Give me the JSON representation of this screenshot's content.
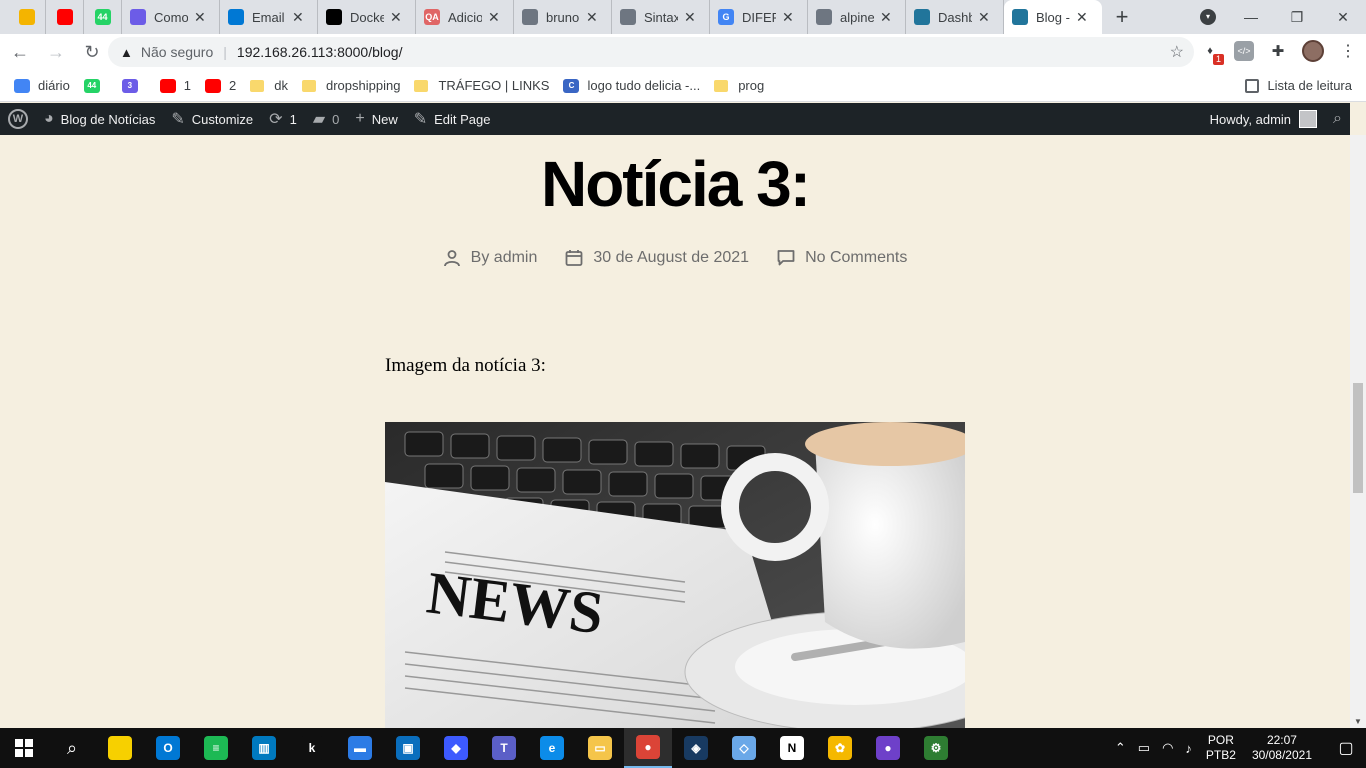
{
  "browser": {
    "tabs": [
      {
        "title": "",
        "favicon_color": "#f4b400",
        "small": true
      },
      {
        "title": "",
        "favicon_color": "#ff0000",
        "small": true
      },
      {
        "title": "",
        "favicon_color": "#25d366",
        "favicon_text": "44",
        "small": true
      },
      {
        "title": "Como",
        "favicon_color": "#6c5ce7"
      },
      {
        "title": "Email",
        "favicon_color": "#0078d4"
      },
      {
        "title": "Docke",
        "favicon_color": "#000000"
      },
      {
        "title": "Adicio",
        "favicon_color": "#e06666",
        "favicon_text": "QA"
      },
      {
        "title": "bruno",
        "favicon_color": "#6e7681"
      },
      {
        "title": "Sintax",
        "favicon_color": "#6e7681"
      },
      {
        "title": "DIFER",
        "favicon_color": "#4285f4",
        "favicon_text": "G"
      },
      {
        "title": "alpine",
        "favicon_color": "#6e7681"
      },
      {
        "title": "Dashb",
        "favicon_color": "#21759b"
      },
      {
        "title": "Blog -",
        "favicon_color": "#21759b",
        "active": true
      }
    ],
    "new_tab_label": "+",
    "address": {
      "security_label": "Não seguro",
      "url": "192.168.26.113:8000/blog/"
    },
    "extension_badge": "1",
    "bookmarks": [
      {
        "label": "diário",
        "type": "icon",
        "color": "#4285f4"
      },
      {
        "label": "",
        "type": "icon",
        "color": "#25d366",
        "icon_text": "44"
      },
      {
        "label": "",
        "type": "icon",
        "color": "#6c5ce7",
        "icon_text": "3"
      },
      {
        "label": "1",
        "type": "icon",
        "color": "#ff0000"
      },
      {
        "label": "2",
        "type": "icon",
        "color": "#ff0000"
      },
      {
        "label": "dk",
        "type": "folder"
      },
      {
        "label": "dropshipping",
        "type": "folder"
      },
      {
        "label": "TRÁFEGO | LINKS",
        "type": "folder"
      },
      {
        "label": "logo tudo delicia -...",
        "type": "icon",
        "color": "#3a66c4",
        "icon_text": "C"
      },
      {
        "label": "prog",
        "type": "folder"
      }
    ],
    "reading_list_label": "Lista de leitura"
  },
  "wp_admin_bar": {
    "site_name": "Blog de Notícias",
    "customize_label": "Customize",
    "updates_count": "1",
    "comments_count": "0",
    "new_label": "New",
    "edit_page_label": "Edit Page",
    "howdy_label": "Howdy, admin"
  },
  "post": {
    "title": "Notícia 3:",
    "author": "By admin",
    "date": "30 de August de 2021",
    "comments": "No Comments",
    "content_text": "Imagem da notícia 3:",
    "image_headline": "NEWS"
  },
  "taskbar": {
    "apps": [
      {
        "name": "sticky-notes",
        "color": "#f7d000",
        "text": ""
      },
      {
        "name": "outlook",
        "color": "#0078d4",
        "text": "O"
      },
      {
        "name": "spotify",
        "color": "#1db954",
        "text": "≡"
      },
      {
        "name": "trello",
        "color": "#0079bf",
        "text": "▥"
      },
      {
        "name": "kaspersky",
        "color": "#101010",
        "text": "k"
      },
      {
        "name": "app-yellow",
        "color": "#2c7be5",
        "text": "▬"
      },
      {
        "name": "remote-desktop",
        "color": "#0a6ebd",
        "text": "▣"
      },
      {
        "name": "app-shield",
        "color": "#3d5afe",
        "text": "◆"
      },
      {
        "name": "teams",
        "color": "#5b5fc7",
        "text": "T"
      },
      {
        "name": "edge",
        "color": "#0c8ce9",
        "text": "e"
      },
      {
        "name": "file-explorer",
        "color": "#f5c54a",
        "text": "▭"
      },
      {
        "name": "chrome",
        "color": "#db4437",
        "text": "●",
        "active": true
      },
      {
        "name": "virtualbox",
        "color": "#183a61",
        "text": "◈"
      },
      {
        "name": "app-blue",
        "color": "#6aa8e8",
        "text": "◇"
      },
      {
        "name": "notion",
        "color": "#ffffff",
        "text": "N"
      },
      {
        "name": "app-folder",
        "color": "#f5b800",
        "text": "✿"
      },
      {
        "name": "github-desktop",
        "color": "#6e40c9",
        "text": "●"
      },
      {
        "name": "network-app",
        "color": "#2e7d32",
        "text": "⚙"
      }
    ],
    "lang_top": "POR",
    "lang_bottom": "PTB2",
    "time": "22:07",
    "date": "30/08/2021"
  }
}
